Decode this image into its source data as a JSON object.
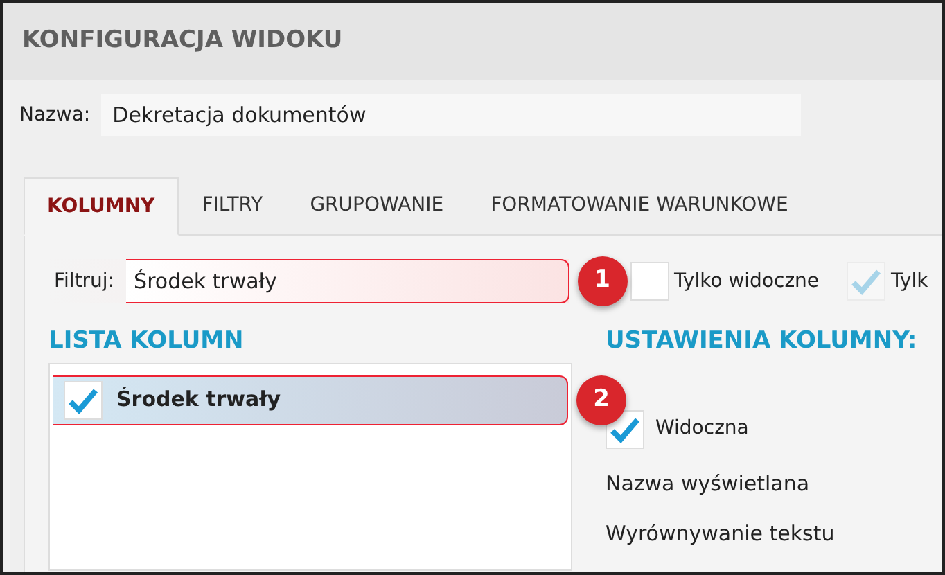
{
  "window": {
    "title": "KONFIGURACJA WIDOKU"
  },
  "name_field": {
    "label": "Nazwa:",
    "value": "Dekretacja dokumentów"
  },
  "tabs": [
    {
      "label": "KOLUMNY",
      "selected": true
    },
    {
      "label": "FILTRY",
      "selected": false
    },
    {
      "label": "GRUPOWANIE",
      "selected": false
    },
    {
      "label": "FORMATOWANIE WARUNKOWE",
      "selected": false
    }
  ],
  "filter": {
    "label": "Filtruj:",
    "value": "Środek trwały",
    "callout": "1"
  },
  "options": [
    {
      "label": "Tylko widoczne",
      "checked": false
    },
    {
      "label": "Tylk",
      "checked": true,
      "disabled": true
    }
  ],
  "column_list": {
    "heading": "LISTA KOLUMN",
    "items": [
      {
        "label": "Środek trwały",
        "checked": true,
        "selected": true,
        "callout": "2"
      }
    ]
  },
  "column_settings": {
    "heading": "USTAWIENIA KOLUMNY:",
    "visible": {
      "label": "Widoczna",
      "checked": true
    },
    "fields": [
      "Nazwa wyświetlana",
      "Wyrównywanie tekstu"
    ]
  }
}
